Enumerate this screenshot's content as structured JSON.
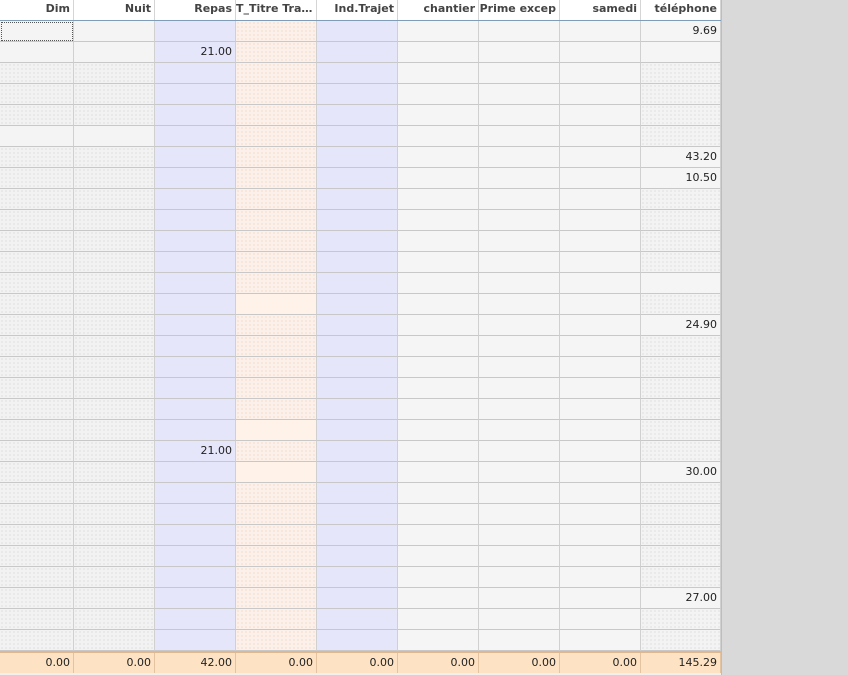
{
  "grid": {
    "columns": [
      {
        "key": "dim",
        "label": "Dim"
      },
      {
        "key": "nuit",
        "label": "Nuit"
      },
      {
        "key": "repas",
        "label": "Repas"
      },
      {
        "key": "titre_transport",
        "label": "T_Titre Tra..."
      },
      {
        "key": "ind_trajet",
        "label": "Ind.Trajet"
      },
      {
        "key": "chantier",
        "label": "chantier"
      },
      {
        "key": "prime_excep",
        "label": "Prime excep"
      },
      {
        "key": "samedi",
        "label": "samedi"
      },
      {
        "key": "telephone",
        "label": "téléphone"
      }
    ],
    "rows": [
      {
        "repas": "",
        "telephone": "9.69"
      },
      {
        "repas": "21.00",
        "telephone": ""
      },
      {
        "repas": "",
        "telephone": ""
      },
      {
        "repas": "",
        "telephone": ""
      },
      {
        "repas": "",
        "telephone": ""
      },
      {
        "repas": "",
        "telephone": ""
      },
      {
        "repas": "",
        "telephone": "43.20"
      },
      {
        "repas": "",
        "telephone": "10.50"
      },
      {
        "repas": "",
        "telephone": ""
      },
      {
        "repas": "",
        "telephone": ""
      },
      {
        "repas": "",
        "telephone": ""
      },
      {
        "repas": "",
        "telephone": ""
      },
      {
        "repas": "",
        "telephone": ""
      },
      {
        "repas": "",
        "telephone": ""
      },
      {
        "repas": "",
        "telephone": "24.90"
      },
      {
        "repas": "",
        "telephone": ""
      },
      {
        "repas": "",
        "telephone": ""
      },
      {
        "repas": "",
        "telephone": ""
      },
      {
        "repas": "",
        "telephone": ""
      },
      {
        "repas": "",
        "telephone": ""
      },
      {
        "repas": "21.00",
        "telephone": ""
      },
      {
        "repas": "",
        "telephone": "30.00"
      },
      {
        "repas": "",
        "telephone": ""
      },
      {
        "repas": "",
        "telephone": ""
      },
      {
        "repas": "",
        "telephone": ""
      },
      {
        "repas": "",
        "telephone": ""
      },
      {
        "repas": "",
        "telephone": ""
      },
      {
        "repas": "",
        "telephone": "27.00"
      },
      {
        "repas": "",
        "telephone": ""
      },
      {
        "repas": "",
        "telephone": ""
      },
      {
        "repas": "",
        "telephone": ""
      }
    ],
    "totals": {
      "dim": "0.00",
      "nuit": "0.00",
      "repas": "42.00",
      "titre_transport": "0.00",
      "ind_trajet": "0.00",
      "chantier": "0.00",
      "prime_excep": "0.00",
      "samedi": "0.00",
      "telephone": "145.29"
    }
  },
  "colors": {
    "repas_column": "#e6e6fb",
    "ind_trajet_column": "#e6e6fb",
    "titre_transport_column": "#fbf1ea",
    "totals_row": "#fde3c4",
    "header_bottom_border": "#7f9db9"
  }
}
